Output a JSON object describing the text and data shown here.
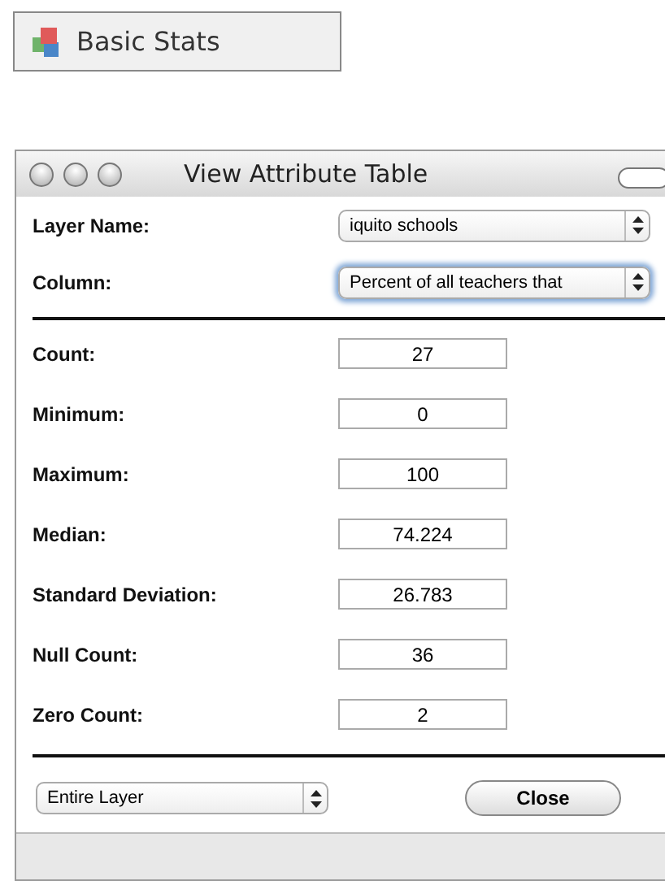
{
  "toolbar_button": {
    "label": "Basic Stats"
  },
  "window": {
    "title": "View Attribute Table"
  },
  "selectors": [
    {
      "label": "Layer Name:",
      "value": "iquito schools",
      "focused": false
    },
    {
      "label": "Column:",
      "value": "Percent of all teachers that",
      "focused": true
    }
  ],
  "stats": [
    {
      "label": "Count:",
      "value": "27"
    },
    {
      "label": "Minimum:",
      "value": "0"
    },
    {
      "label": "Maximum:",
      "value": "100"
    },
    {
      "label": "Median:",
      "value": "74.224"
    },
    {
      "label": "Standard Deviation:",
      "value": "26.783"
    },
    {
      "label": "Null Count:",
      "value": "36"
    },
    {
      "label": "Zero Count:",
      "value": "2"
    }
  ],
  "scope": {
    "value": "Entire Layer"
  },
  "buttons": [
    "Close"
  ]
}
